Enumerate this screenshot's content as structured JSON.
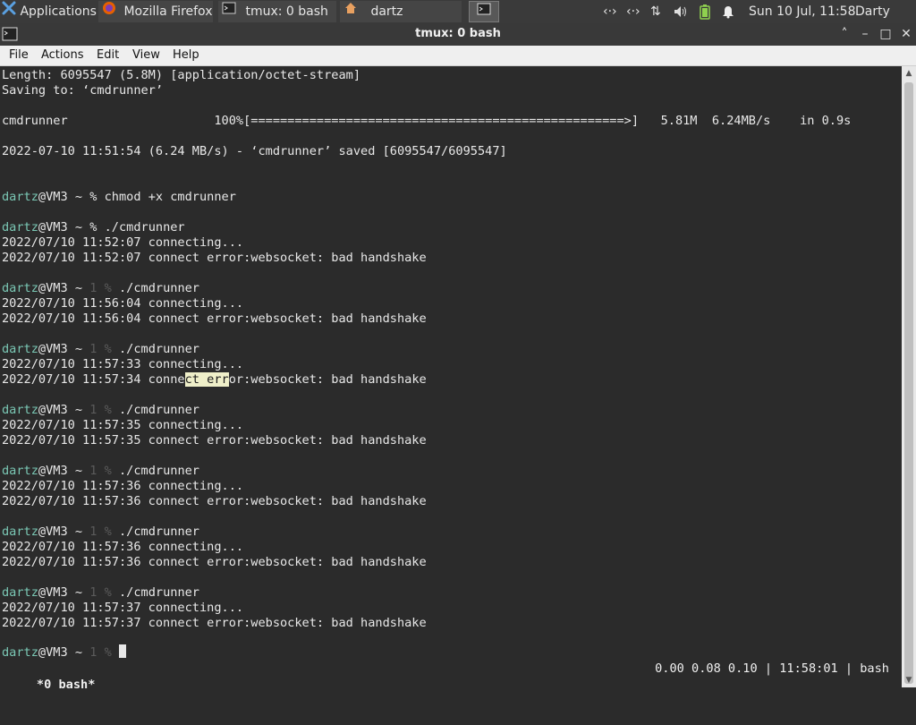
{
  "panel": {
    "apps_label": "Applications",
    "tasks": [
      {
        "label": "Mozilla Firefox"
      },
      {
        "label": "tmux: 0 bash"
      },
      {
        "label": "dartz"
      }
    ],
    "clock": "Sun 10 Jul, 11:58",
    "user": "Darty uwu"
  },
  "window": {
    "title": "tmux: 0 bash",
    "menu": [
      "File",
      "Actions",
      "Edit",
      "View",
      "Help"
    ]
  },
  "terminal": {
    "lines": [
      "Length: 6095547 (5.8M) [application/octet-stream]",
      "Saving to: ‘cmdrunner’",
      "",
      "cmdrunner                    100%[===================================================>]   5.81M  6.24MB/s    in 0.9s",
      "",
      "2022-07-10 11:51:54 (6.24 MB/s) - ‘cmdrunner’ saved [6095547/6095547]",
      "",
      "",
      "chmod +x cmdrunner",
      "",
      "./cmdrunner",
      "2022/07/10 11:52:07 connecting...",
      "2022/07/10 11:52:07 connect error:websocket: bad handshake",
      "",
      "./cmdrunner",
      "2022/07/10 11:56:04 connecting...",
      "2022/07/10 11:56:04 connect error:websocket: bad handshake",
      "",
      "./cmdrunner",
      "2022/07/10 11:57:33 connecting...",
      "2022/07/10 11:57:34 connect error:websocket: bad handshake",
      "",
      "./cmdrunner",
      "2022/07/10 11:57:35 connecting...",
      "2022/07/10 11:57:35 connect error:websocket: bad handshake",
      "",
      "./cmdrunner",
      "2022/07/10 11:57:36 connecting...",
      "2022/07/10 11:57:36 connect error:websocket: bad handshake",
      "",
      "./cmdrunner",
      "2022/07/10 11:57:36 connecting...",
      "2022/07/10 11:57:36 connect error:websocket: bad handshake",
      "",
      "./cmdrunner",
      "2022/07/10 11:57:37 connecting...",
      "2022/07/10 11:57:37 connect error:websocket: bad handshake",
      ""
    ],
    "prompt": {
      "user": "dartz",
      "host": "@VM3 ~ ",
      "ok_symbol": "% ",
      "err_code": "1 ",
      "err_symbol": "% "
    },
    "selected_text": "ct err",
    "status_left": " *0 bash*",
    "status_right": "0.00 0.08 0.10 | 11:58:01 | bash"
  },
  "colors": {
    "prompt_user": "#7ac7b4",
    "selection": "#efefc9",
    "background": "#2b2b2b"
  }
}
